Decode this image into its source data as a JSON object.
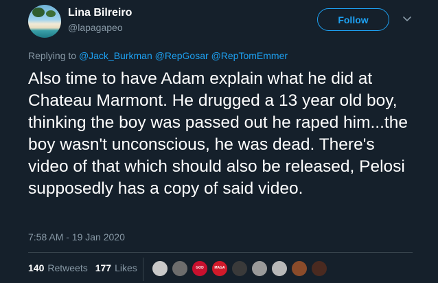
{
  "user": {
    "display_name": "Lina Bilreiro",
    "handle": "@lapagapeo",
    "avatar_icon": "beach-avatar-icon"
  },
  "follow_button": {
    "label": "Follow",
    "color": "#1da1f2"
  },
  "reply": {
    "prefix": "Replying to",
    "mentions": [
      "@Jack_Burkman",
      "@RepGosar",
      "@RepTomEmmer"
    ]
  },
  "tweet": {
    "text": "Also time to have Adam explain what he did at Chateau Marmont. He drugged a 13 year old boy, thinking the boy was passed out he raped him...the boy wasn't unconscious, he was dead. There's video of that which should also be released, Pelosi supposedly has a copy of said video.",
    "timestamp": "7:58 AM - 19 Jan 2020"
  },
  "stats": {
    "retweets_count": "140",
    "retweets_label": "Retweets",
    "likes_count": "177",
    "likes_label": "Likes"
  },
  "likers": [
    {
      "icon": "liker-avatar-1",
      "color": "#c9c9c9",
      "text": ""
    },
    {
      "icon": "liker-avatar-2",
      "color": "#6d6d6d",
      "text": ""
    },
    {
      "icon": "liker-avatar-3",
      "color": "#c8102e",
      "text": "GOD"
    },
    {
      "icon": "liker-avatar-4",
      "color": "#d11a2a",
      "text": "MAGA"
    },
    {
      "icon": "liker-avatar-5",
      "color": "#3a3a3a",
      "text": ""
    },
    {
      "icon": "liker-avatar-6",
      "color": "#9a9a9a",
      "text": ""
    },
    {
      "icon": "liker-avatar-7",
      "color": "#b8b8b8",
      "text": ""
    },
    {
      "icon": "liker-avatar-8",
      "color": "#8a4b2a",
      "text": ""
    },
    {
      "icon": "liker-avatar-9",
      "color": "#4a2a20",
      "text": ""
    }
  ],
  "colors": {
    "background": "#15202b",
    "secondary_text": "#8899a6",
    "accent": "#1da1f2",
    "border": "#38444d"
  }
}
